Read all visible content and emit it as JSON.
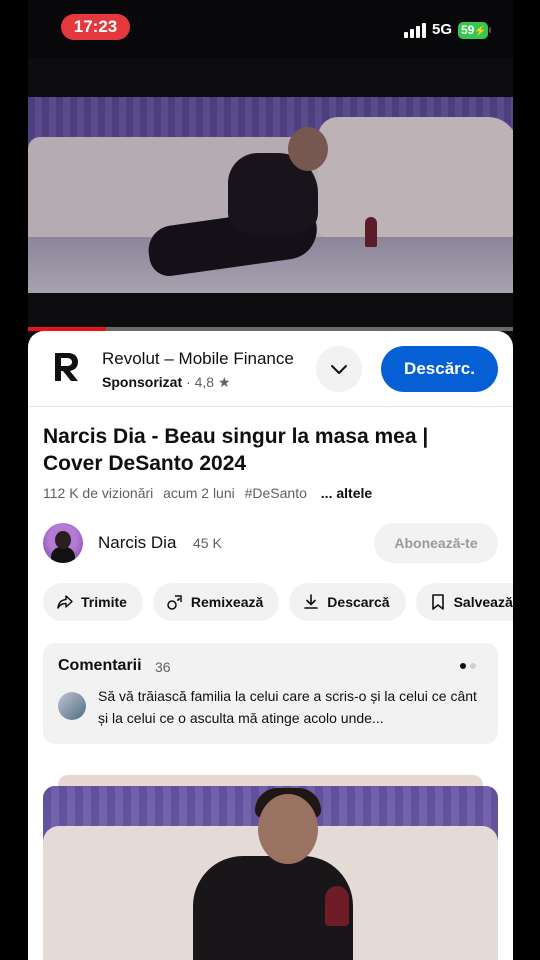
{
  "status_bar": {
    "time": "17:23",
    "network": "5G",
    "battery": "59"
  },
  "video": {
    "progress_fraction": 0.16
  },
  "ad": {
    "title": "Revolut – Mobile Finance",
    "sponsored_label": "Sponsorizat",
    "rating": "4,8",
    "cta_label": "Descărc."
  },
  "video_info": {
    "title": "Narcis Dia - Beau singur la masa mea | Cover DeSanto 2024",
    "views": "112 K de vizionări",
    "age": "acum 2 luni",
    "hashtag": "#DeSanto",
    "more_label": "... altele"
  },
  "channel": {
    "name": "Narcis Dia",
    "subscribers": "45 K",
    "subscribe_label": "Abonează-te"
  },
  "actions": {
    "share": "Trimite",
    "remix": "Remixează",
    "download": "Descarcă",
    "save": "Salvează"
  },
  "comments": {
    "label": "Comentarii",
    "count": "36",
    "top_comment": "Să vă trăiască familia la celui care a scris-o și la celui ce cânt și la celui ce o asculta mă atinge acolo unde..."
  },
  "colors": {
    "accent_red": "#e5141b",
    "cta_blue": "#065fd4",
    "time_pill": "#e3383e",
    "battery_green": "#36c74f"
  },
  "icons": [
    "chevron-down-icon",
    "share-icon",
    "remix-icon",
    "download-icon",
    "bookmark-icon",
    "star-icon",
    "signal-icon",
    "battery-icon"
  ]
}
